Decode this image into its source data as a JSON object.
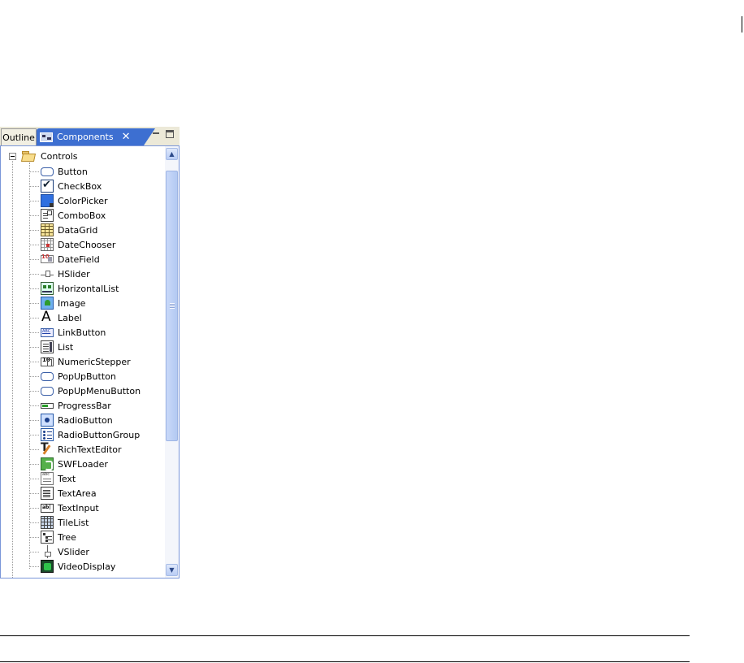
{
  "panel": {
    "tabs": [
      {
        "label": "Outline"
      },
      {
        "label": "Components",
        "active": true,
        "icon": "components-icon",
        "close": "✕"
      }
    ],
    "view_buttons": {
      "minimize_icon": "minimize-icon",
      "maximize_icon": "maximize-icon"
    }
  },
  "tree": {
    "root": {
      "label": "Controls",
      "icon": "folder-open-icon",
      "expanded": true
    },
    "items": [
      {
        "label": "Button",
        "icon": "button-icon"
      },
      {
        "label": "CheckBox",
        "icon": "checkbox-icon"
      },
      {
        "label": "ColorPicker",
        "icon": "colorpicker-icon"
      },
      {
        "label": "ComboBox",
        "icon": "combobox-icon"
      },
      {
        "label": "DataGrid",
        "icon": "datagrid-icon"
      },
      {
        "label": "DateChooser",
        "icon": "datechooser-icon"
      },
      {
        "label": "DateField",
        "icon": "datefield-icon"
      },
      {
        "label": "HSlider",
        "icon": "hslider-icon"
      },
      {
        "label": "HorizontalList",
        "icon": "horizontallist-icon"
      },
      {
        "label": "Image",
        "icon": "image-icon"
      },
      {
        "label": "Label",
        "icon": "label-icon"
      },
      {
        "label": "LinkButton",
        "icon": "linkbutton-icon"
      },
      {
        "label": "List",
        "icon": "list-icon"
      },
      {
        "label": "NumericStepper",
        "icon": "numericstepper-icon"
      },
      {
        "label": "PopUpButton",
        "icon": "popupbutton-icon"
      },
      {
        "label": "PopUpMenuButton",
        "icon": "popupmenubutton-icon"
      },
      {
        "label": "ProgressBar",
        "icon": "progressbar-icon"
      },
      {
        "label": "RadioButton",
        "icon": "radiobutton-icon"
      },
      {
        "label": "RadioButtonGroup",
        "icon": "radiobuttongroup-icon"
      },
      {
        "label": "RichTextEditor",
        "icon": "richtexteditor-icon"
      },
      {
        "label": "SWFLoader",
        "icon": "swfloader-icon"
      },
      {
        "label": "Text",
        "icon": "text-icon"
      },
      {
        "label": "TextArea",
        "icon": "textarea-icon"
      },
      {
        "label": "TextInput",
        "icon": "textinput-icon"
      },
      {
        "label": "TileList",
        "icon": "tilelist-icon"
      },
      {
        "label": "Tree",
        "icon": "tree-icon"
      },
      {
        "label": "VSlider",
        "icon": "vslider-icon"
      },
      {
        "label": "VideoDisplay",
        "icon": "videodisplay-icon"
      }
    ]
  },
  "scrollbar": {
    "up_icon": "scroll-up-icon",
    "down_icon": "scroll-down-icon"
  },
  "colors": {
    "active_tab": "#3d6fd1",
    "panel_border": "#7a96d9",
    "tab_bar": "#ece9d8"
  }
}
